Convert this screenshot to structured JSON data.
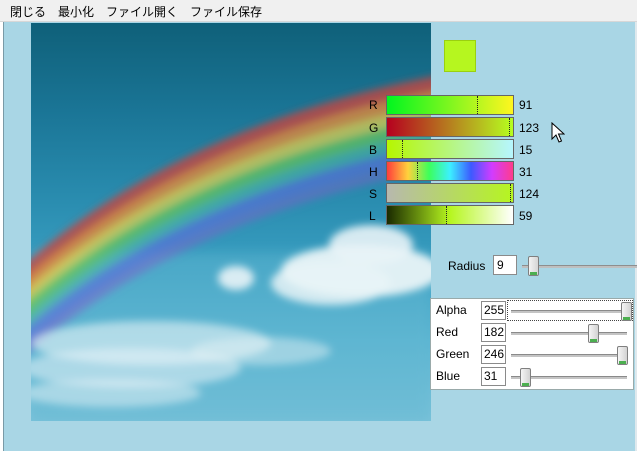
{
  "menu": [
    "閉じる",
    "最小化",
    "ファイル開く",
    "ファイル保存"
  ],
  "swatch_color": "#b6f61f",
  "bars": [
    {
      "label": "R",
      "value": "91"
    },
    {
      "label": "G",
      "value": "123"
    },
    {
      "label": "B",
      "value": "15"
    },
    {
      "label": "H",
      "value": "31"
    },
    {
      "label": "S",
      "value": "124"
    },
    {
      "label": "L",
      "value": "59"
    }
  ],
  "radius": {
    "label": "Radius",
    "value": "9"
  },
  "argb": [
    {
      "label": "Alpha",
      "value": "255"
    },
    {
      "label": "Red",
      "value": "182"
    },
    {
      "label": "Green",
      "value": "246"
    },
    {
      "label": "Blue",
      "value": "31"
    }
  ]
}
